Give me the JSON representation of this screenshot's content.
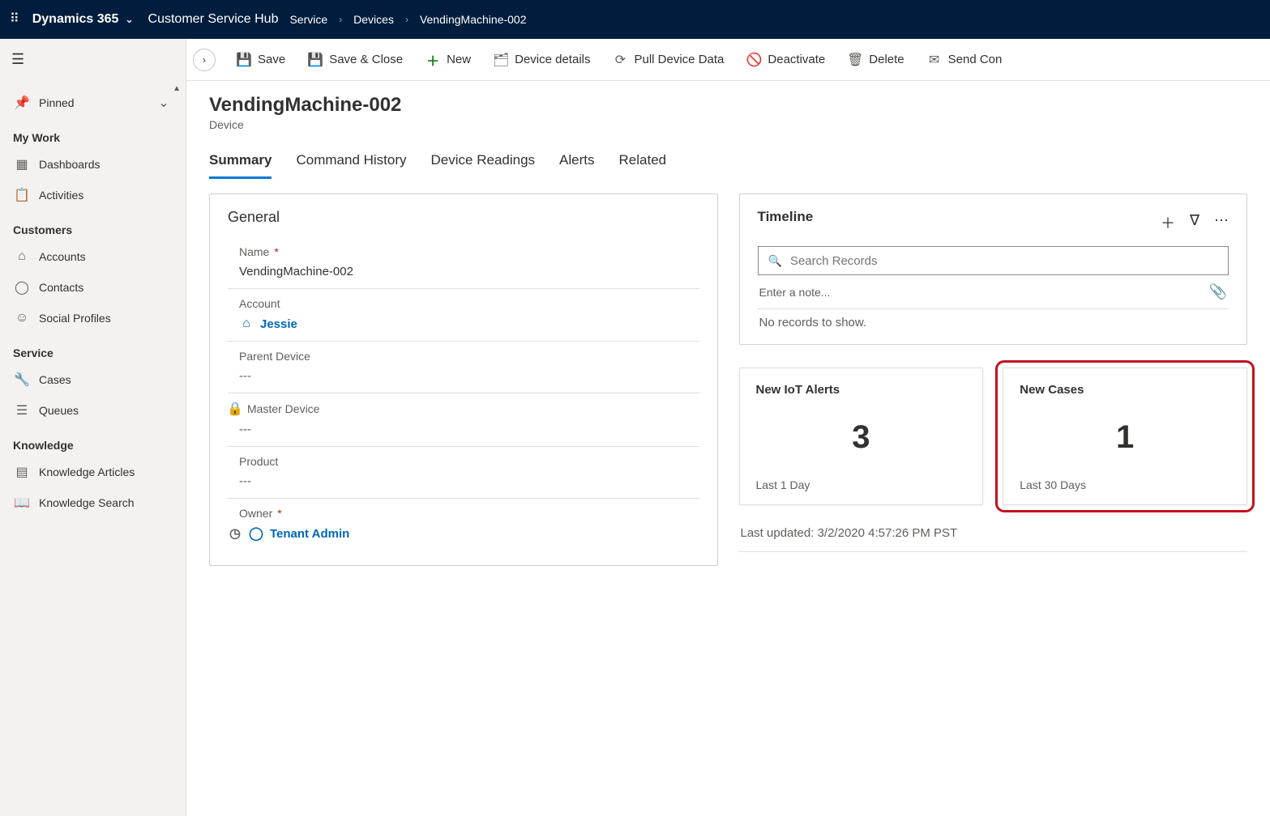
{
  "topnav": {
    "brand": "Dynamics 365",
    "hub": "Customer Service Hub",
    "crumbs": [
      "Service",
      "Devices",
      "VendingMachine-002"
    ]
  },
  "sidebar": {
    "pinned_label": "Pinned",
    "groups": [
      {
        "title": "My Work",
        "items": [
          {
            "label": "Dashboards",
            "icon": "dashboard-icon"
          },
          {
            "label": "Activities",
            "icon": "clipboard-icon"
          }
        ]
      },
      {
        "title": "Customers",
        "items": [
          {
            "label": "Accounts",
            "icon": "account-icon"
          },
          {
            "label": "Contacts",
            "icon": "person-icon"
          },
          {
            "label": "Social Profiles",
            "icon": "social-icon"
          }
        ]
      },
      {
        "title": "Service",
        "items": [
          {
            "label": "Cases",
            "icon": "wrench-icon"
          },
          {
            "label": "Queues",
            "icon": "queue-icon"
          }
        ]
      },
      {
        "title": "Knowledge",
        "items": [
          {
            "label": "Knowledge Articles",
            "icon": "article-icon"
          },
          {
            "label": "Knowledge Search",
            "icon": "book-icon"
          }
        ]
      }
    ]
  },
  "commands": [
    {
      "label": "Save",
      "icon": "save-icon"
    },
    {
      "label": "Save & Close",
      "icon": "saveclose-icon"
    },
    {
      "label": "New",
      "icon": "plus-icon",
      "color": "#107c10"
    },
    {
      "label": "Device details",
      "icon": "details-icon"
    },
    {
      "label": "Pull Device Data",
      "icon": "pull-icon"
    },
    {
      "label": "Deactivate",
      "icon": "deactivate-icon"
    },
    {
      "label": "Delete",
      "icon": "delete-icon"
    },
    {
      "label": "Send Con",
      "icon": "send-icon"
    }
  ],
  "page": {
    "title": "VendingMachine-002",
    "entity": "Device",
    "tabs": [
      "Summary",
      "Command History",
      "Device Readings",
      "Alerts",
      "Related"
    ],
    "active_tab": "Summary"
  },
  "general": {
    "heading": "General",
    "fields": {
      "name": {
        "label": "Name",
        "required": true,
        "value": "VendingMachine-002"
      },
      "account": {
        "label": "Account",
        "link": true,
        "value": "Jessie",
        "icon": "account-icon"
      },
      "parent": {
        "label": "Parent Device",
        "value": "---"
      },
      "master": {
        "label": "Master Device",
        "value": "---",
        "lock": true
      },
      "product": {
        "label": "Product",
        "value": "---"
      },
      "owner": {
        "label": "Owner",
        "required": true,
        "link": true,
        "value": "Tenant Admin",
        "icon": "person-icon",
        "recent": true
      }
    }
  },
  "timeline": {
    "heading": "Timeline",
    "search_placeholder": "Search Records",
    "note_placeholder": "Enter a note...",
    "empty": "No records to show."
  },
  "stats": {
    "alerts": {
      "title": "New IoT Alerts",
      "value": "3",
      "footer": "Last 1 Day"
    },
    "cases": {
      "title": "New Cases",
      "value": "1",
      "footer": "Last 30 Days"
    },
    "updated": "Last updated: 3/2/2020 4:57:26 PM PST"
  }
}
